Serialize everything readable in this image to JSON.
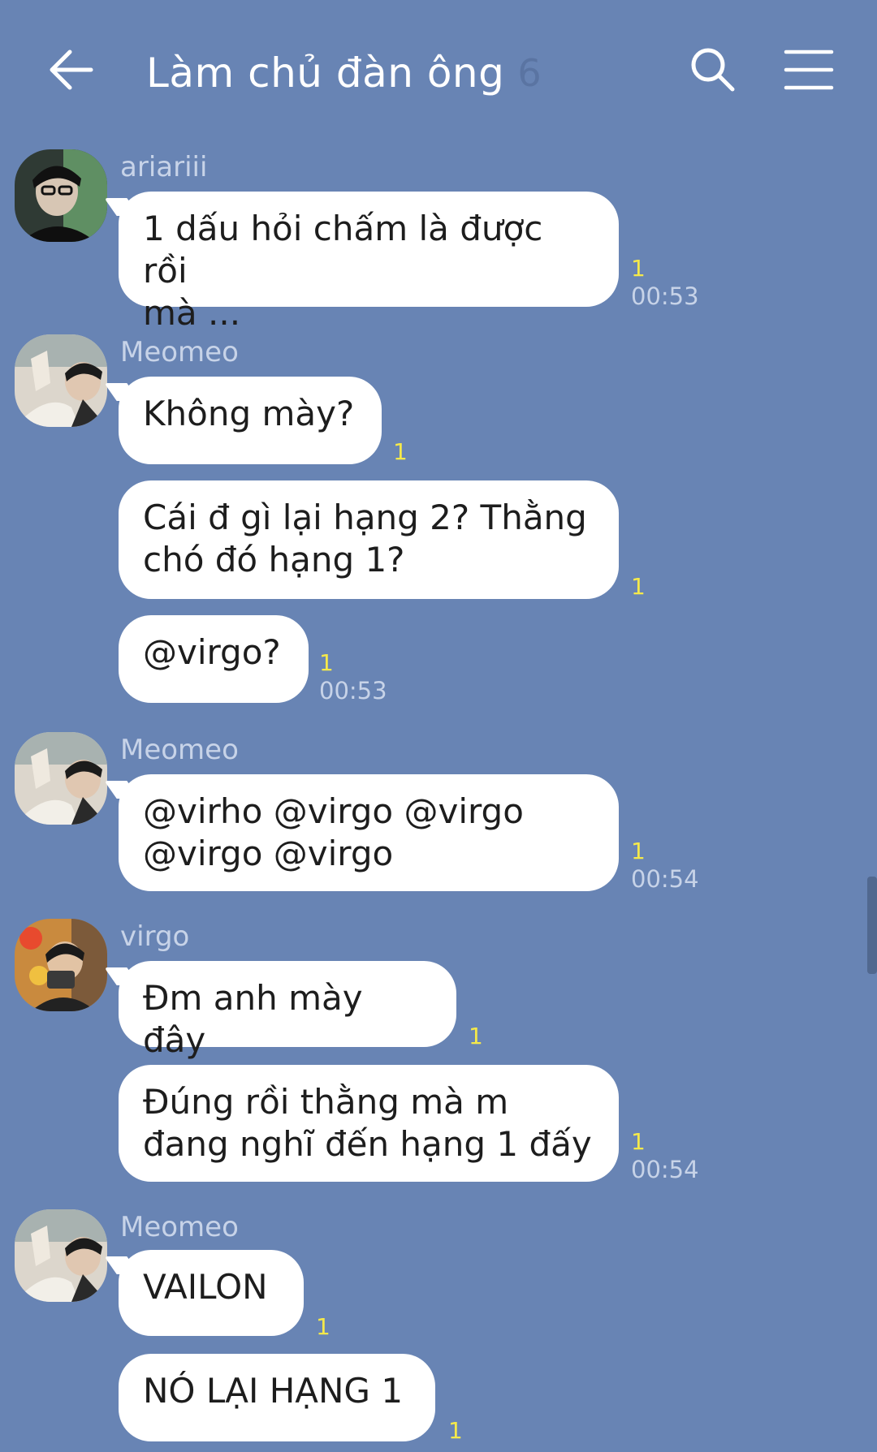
{
  "header": {
    "title": "Làm chủ đàn ông",
    "member_count": "6"
  },
  "messages": [
    {
      "sender": "ariariii",
      "text": "1 dấu hỏi chấm là được rồi\nmà ...",
      "read": "1",
      "time": "00:53"
    },
    {
      "sender": "Meomeo",
      "text": "Không mày?",
      "read": "1",
      "time": ""
    },
    {
      "sender": "",
      "text": "Cái đ gì lại hạng 2? Thằng\nchó đó hạng 1?",
      "read": "1",
      "time": ""
    },
    {
      "sender": "",
      "text": "@virgo?",
      "read": "1",
      "time": "00:53"
    },
    {
      "sender": "Meomeo",
      "text": "@virho @virgo @virgo\n@virgo @virgo",
      "read": "1",
      "time": "00:54"
    },
    {
      "sender": "virgo",
      "text": "Đm anh mày đây",
      "read": "1",
      "time": ""
    },
    {
      "sender": "",
      "text": "Đúng rồi thằng mà m\nđang nghĩ đến hạng 1 đấy",
      "read": "1",
      "time": "00:54"
    },
    {
      "sender": "Meomeo",
      "text": "VAILON",
      "read": "1",
      "time": ""
    },
    {
      "sender": "",
      "text": "NÓ LẠI HẠNG 1",
      "read": "1",
      "time": ""
    }
  ],
  "colors": {
    "background": "#6884b4",
    "bubble": "#ffffff",
    "read_count": "#f5e94a",
    "meta_text": "#c7d3e8"
  },
  "icons": {
    "back": "back-arrow-icon",
    "search": "search-icon",
    "menu": "hamburger-menu-icon"
  }
}
